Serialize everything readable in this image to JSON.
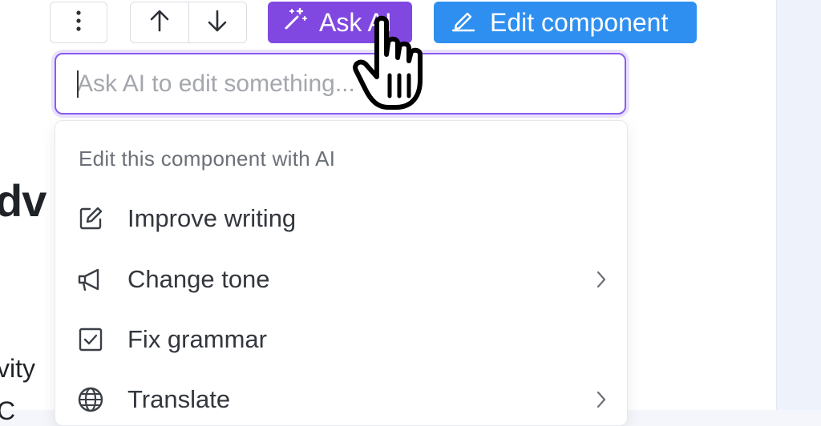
{
  "page_background": {
    "heading_fragment": "dv",
    "line1_fragment": "vity",
    "line2_fragment": "C"
  },
  "toolbar": {
    "more_icon": "more-vertical-icon",
    "move_up_icon": "arrow-up-icon",
    "move_down_icon": "arrow-down-icon",
    "ask_ai_label": "Ask AI",
    "ask_ai_icon": "magic-wand-icon",
    "edit_label": "Edit component",
    "edit_icon": "pencil-icon"
  },
  "ai_input": {
    "value": "",
    "placeholder": "Ask AI to edit something..."
  },
  "menu": {
    "heading": "Edit this component with AI",
    "items": [
      {
        "label": "Improve writing",
        "icon": "edit-square-icon",
        "has_submenu": false
      },
      {
        "label": "Change tone",
        "icon": "megaphone-icon",
        "has_submenu": true
      },
      {
        "label": "Fix grammar",
        "icon": "checkbox-icon",
        "has_submenu": false
      },
      {
        "label": "Translate",
        "icon": "globe-icon",
        "has_submenu": true
      }
    ]
  },
  "colors": {
    "ask_ai": "#8048e0",
    "edit_component": "#2f8ff0",
    "focus_ring": "#8a5cf0"
  }
}
